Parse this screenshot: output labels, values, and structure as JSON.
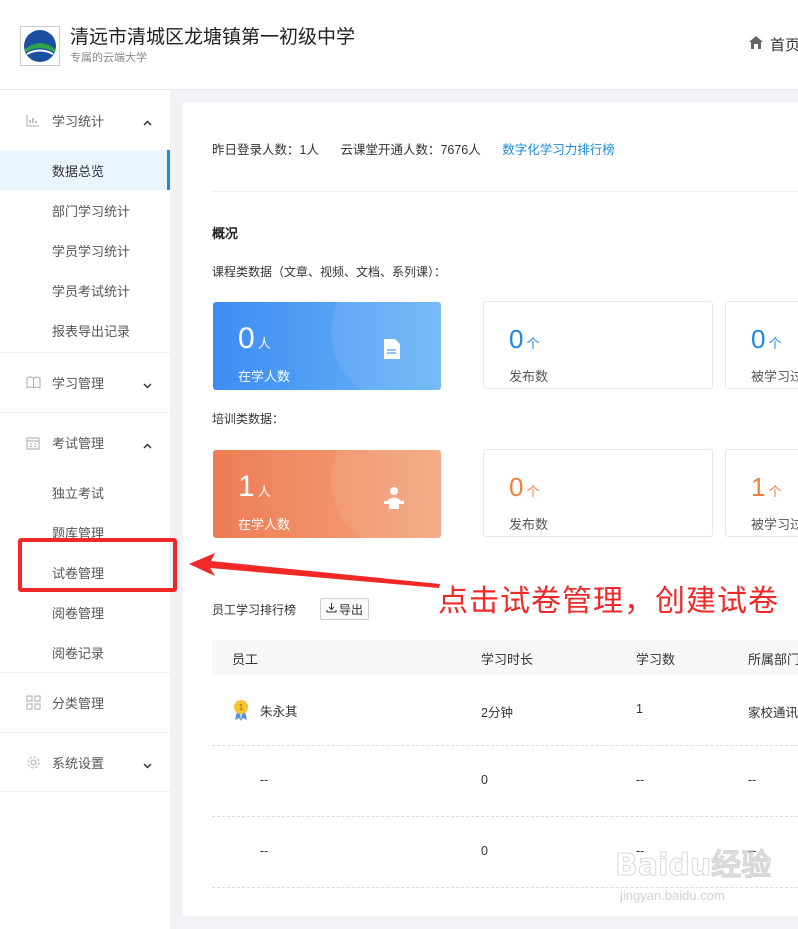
{
  "header": {
    "school_name": "清远市清城区龙塘镇第一初级中学",
    "subtitle": "专属的云端大学",
    "home_label": "首页"
  },
  "sidebar": {
    "groups": [
      {
        "label": "学习统计",
        "icon": "chart-icon",
        "expanded": true,
        "items": [
          "数据总览",
          "部门学习统计",
          "学员学习统计",
          "学员考试统计",
          "报表导出记录"
        ]
      },
      {
        "label": "学习管理",
        "icon": "book-icon",
        "expanded": false,
        "items": []
      },
      {
        "label": "考试管理",
        "icon": "calendar-icon",
        "expanded": true,
        "items": [
          "独立考试",
          "题库管理",
          "试卷管理",
          "阅卷管理",
          "阅卷记录"
        ]
      },
      {
        "label": "分类管理",
        "icon": "grid-icon",
        "expanded": null,
        "items": []
      },
      {
        "label": "系统设置",
        "icon": "gear-icon",
        "expanded": false,
        "items": []
      }
    ],
    "active_item": "数据总览"
  },
  "main": {
    "login_stat": "昨日登录人数：1人",
    "open_stat": "云课堂开通人数：7676人",
    "ranking_link": "数字化学习力排行榜",
    "overview_title": "概况",
    "course_section_label": "课程类数据（文章、视频、文档、系列课）：",
    "training_section_label": "培训类数据：",
    "course_cards": {
      "learners": {
        "value": "0",
        "unit": "人",
        "label": "在学人数"
      },
      "published": {
        "value": "0",
        "unit": "个",
        "label": "发布数"
      },
      "studied": {
        "value": "0",
        "unit": "个",
        "label": "被学习过"
      }
    },
    "training_cards": {
      "learners": {
        "value": "1",
        "unit": "人",
        "label": "在学人数"
      },
      "published": {
        "value": "0",
        "unit": "个",
        "label": "发布数"
      },
      "studied": {
        "value": "1",
        "unit": "个",
        "label": "被学习过"
      }
    },
    "rank_title": "员工学习排行榜",
    "export_label": "导出",
    "table": {
      "columns": [
        "员工",
        "学习时长",
        "学习数",
        "所属部门"
      ],
      "rows": [
        {
          "name": "朱永其",
          "duration": "2分钟",
          "count": "1",
          "dept": "家校通讯"
        },
        {
          "name": "--",
          "duration": "0",
          "count": "--",
          "dept": "--"
        },
        {
          "name": "--",
          "duration": "0",
          "count": "--",
          "dept": "--"
        }
      ]
    }
  },
  "annotation": {
    "text": "点击试卷管理，创建试卷",
    "color": "#f02828"
  },
  "watermark": {
    "main": "Baidu经验",
    "sub": "jingyan.baidu.com"
  },
  "colors": {
    "accent": "#1e88e5",
    "blue_card": "#3d8cf4",
    "orange_card": "#ee7d55",
    "link": "#1a8cd8"
  }
}
